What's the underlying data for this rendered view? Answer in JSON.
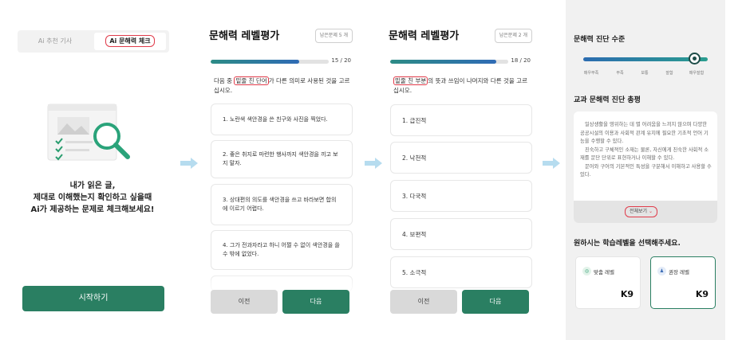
{
  "screen1": {
    "tabs": [
      {
        "label": "Ai 추천 기사"
      },
      {
        "label": "Ai 문해력 체크"
      }
    ],
    "intro_lines": [
      "내가 읽은 글,",
      "제대로 이해했는지 확인하고 싶을때",
      "Ai가 제공하는 문제로 체크해보세요!"
    ],
    "start_label": "시작하기"
  },
  "screen2": {
    "title": "문해력 레벨평가",
    "remaining": "남은문제 5 개",
    "progress": {
      "current": 15,
      "total": 20,
      "label": "15 / 20"
    },
    "question": {
      "before": "다음 중 ",
      "highlight": "밑줄 친 단어",
      "after": "가 다른 의미로 사용된 것을 고르십시오."
    },
    "options": [
      "1. 노란색 색안경을 쓴 친구와 사진을 찍었다.",
      "2. 좋은 취지로 마련한 행사까지 색안경을 끼고 보지 말자.",
      "3. 상대편의 의도를 색안경을 쓰고 바라보면 합의에 이르기 어렵다.",
      "4. 그가 전과자라고 하니 어쩔 수 없이 색안경을 쓸 수 밖에 없었다."
    ],
    "prev_label": "이전",
    "next_label": "다음"
  },
  "screen3": {
    "title": "문해력 레벨평가",
    "remaining": "남은문제 2 개",
    "progress": {
      "current": 18,
      "total": 20,
      "label": "18 / 20"
    },
    "question": {
      "before": "",
      "highlight": "밑줄 친 부분",
      "after": "의 뜻과 쓰임이 나머지와 다른 것을 고르십시오."
    },
    "options": [
      "1. 급진적",
      "2. 낙천적",
      "3. 다국적",
      "4. 보편적",
      "5. 소극적"
    ],
    "prev_label": "이전",
    "next_label": "다음"
  },
  "screen4": {
    "level_title": "문해력 진단 수준",
    "level_labels": [
      "매우부족",
      "부족",
      "보통",
      "잘함",
      "매우잘함"
    ],
    "level_value": 0.96,
    "summary_title": "교과 문해력 진단 총평",
    "summary_paragraphs": [
      "일상생활을 영위하는 데 별 어려움을 느끼지 않으며 다양한 공공시설의 이용과 사회적 관계 유지에 필요한 기초적 언어 기능을 수행할 수 있다.",
      "친숙하고 구체적인 소재는 물론, 자신에게 친숙한 사회적 소재를 문단 단위로 표현하거나 이해할 수 있다.",
      "문어와 구어의 기본적인 특성을 구분해서 이해하고 사용할 수 있다."
    ],
    "more_label": "전체보기",
    "select_prompt": "원하시는 학습레벨을 선택해주세요.",
    "levels": [
      {
        "name": "맞춤 레벨",
        "value": "K9"
      },
      {
        "name": "권장 레벨",
        "value": "K9"
      }
    ]
  }
}
